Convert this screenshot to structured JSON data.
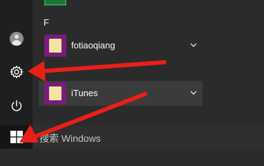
{
  "start_menu": {
    "section_letter": "F",
    "apps": [
      {
        "label": "fotiaoqiang",
        "icon": "folder-icon",
        "expandable": true
      },
      {
        "label": "iTunes",
        "icon": "folder-icon",
        "expandable": true
      }
    ]
  },
  "rail": {
    "items": [
      {
        "icon": "user-avatar-icon"
      },
      {
        "icon": "gear-icon"
      },
      {
        "icon": "power-icon"
      }
    ]
  },
  "taskbar": {
    "start_icon": "windows-logo-icon",
    "search_placeholder": "搜索 Windows"
  },
  "colors": {
    "annotation_arrow": "#e8201a",
    "app_tile": "#7a1c7a"
  }
}
